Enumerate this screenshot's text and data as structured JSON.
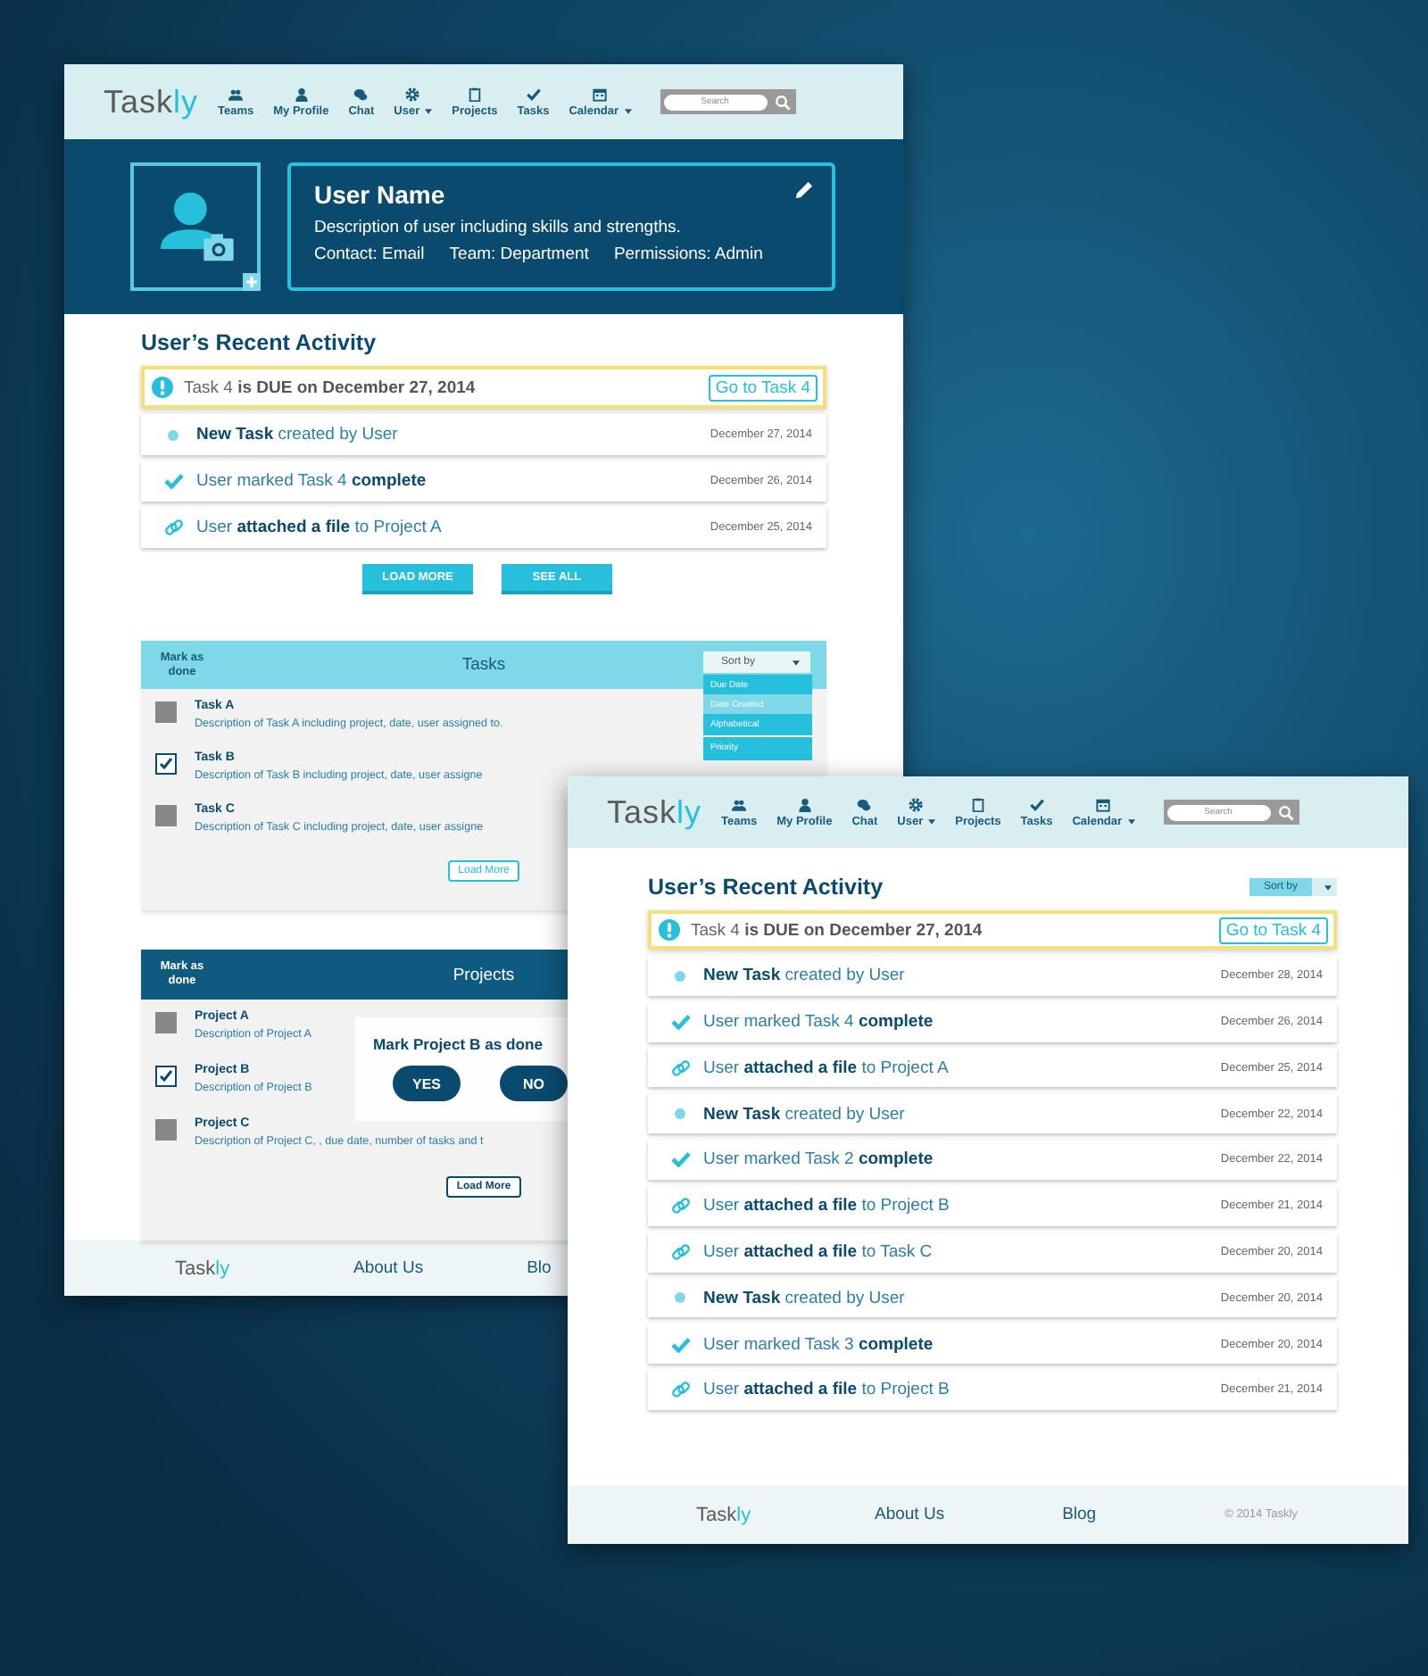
{
  "windows": [
    {
      "kind": "profile",
      "nav": {
        "logo": {
          "main": "Task",
          "accent": "ly"
        },
        "search": {
          "placeholder": "Search"
        },
        "items": [
          {
            "kind": "teams",
            "label": "Teams",
            "dropdown": false
          },
          {
            "kind": "profile",
            "label": "My Profile",
            "dropdown": false
          },
          {
            "kind": "chat",
            "label": "Chat",
            "dropdown": false
          },
          {
            "kind": "user",
            "label": "User",
            "dropdown": true
          },
          {
            "kind": "projects",
            "label": "Projects",
            "dropdown": false
          },
          {
            "kind": "tasks",
            "label": "Tasks",
            "dropdown": false
          },
          {
            "kind": "calendar",
            "label": "Calendar",
            "dropdown": true
          }
        ]
      },
      "profile": {
        "name": "User Name",
        "description": "Description of user including skills and strengths.",
        "contact": "Contact: Email",
        "team": "Team: Department",
        "permissions": "Permissions: Admin"
      },
      "activity": {
        "title": "User’s Recent Activity",
        "alert": {
          "text": "Task 4 **is DUE on December 27, 2014**",
          "button": "Go to Task 4"
        },
        "items": [
          {
            "kind": "new",
            "text": "**New Task** created by User",
            "date": "December 27, 2014"
          },
          {
            "kind": "complete",
            "text": "User marked Task 4 **complete**",
            "date": "December 26, 2014"
          },
          {
            "kind": "attach",
            "text": "User **attached a file** to Project A",
            "date": "December 25, 2014"
          }
        ],
        "buttons": [
          "LOAD MORE",
          "SEE ALL"
        ]
      },
      "tasks": {
        "mark_label": "Mark as done",
        "title": "Tasks",
        "sort": {
          "label": "Sort by",
          "options": [
            {
              "label": "Due Date",
              "selected": false
            },
            {
              "label": "Date Created",
              "selected": true
            },
            {
              "label": "Alphabetical",
              "selected": false
            },
            {
              "label": "Priority",
              "selected": false
            }
          ]
        },
        "items": [
          {
            "title": "Task A",
            "description": "Description of Task A including  project, date, user assigned to.",
            "checked": false
          },
          {
            "title": "Task B",
            "description": "Description of Task B  including  project, date, user assigne",
            "checked": true
          },
          {
            "title": "Task C",
            "description": "Description of Task C  including  project, date, user assigne",
            "checked": false
          }
        ],
        "button": "Load More"
      },
      "projects": {
        "mark_label": "Mark as done",
        "title": "Projects",
        "items": [
          {
            "title": "Project A",
            "description": "Description of Project A",
            "checked": false
          },
          {
            "title": "Project B",
            "description": "Description of Project B",
            "checked": true
          },
          {
            "title": "Project C",
            "description": "Description of Project C, , due date, number of tasks and t",
            "checked": false
          }
        ],
        "button": "Load More",
        "dialog": {
          "text": "Mark Project B as done",
          "buttons": [
            "YES",
            "NO"
          ]
        }
      },
      "footer": {
        "logo": {
          "main": "Task",
          "accent": "ly"
        },
        "links": [
          "About Us",
          "Blo"
        ]
      }
    },
    {
      "kind": "activity",
      "nav": {
        "logo": {
          "main": "Task",
          "accent": "ly"
        },
        "search": {
          "placeholder": "Search"
        },
        "items": [
          {
            "kind": "teams",
            "label": "Teams",
            "dropdown": false
          },
          {
            "kind": "profile",
            "label": "My Profile",
            "dropdown": false
          },
          {
            "kind": "chat",
            "label": "Chat",
            "dropdown": false
          },
          {
            "kind": "user",
            "label": "User",
            "dropdown": true
          },
          {
            "kind": "projects",
            "label": "Projects",
            "dropdown": false
          },
          {
            "kind": "tasks",
            "label": "Tasks",
            "dropdown": false
          },
          {
            "kind": "calendar",
            "label": "Calendar",
            "dropdown": true
          }
        ]
      },
      "activity": {
        "title": "User’s Recent Activity",
        "sort": {
          "label": "Sort by"
        },
        "alert": {
          "text": "Task 4 **is DUE on December 27, 2014**",
          "button": "Go to Task 4"
        },
        "items": [
          {
            "kind": "new",
            "text": "**New Task** created by User",
            "date": "December 28, 2014"
          },
          {
            "kind": "complete",
            "text": "User marked Task 4 **complete**",
            "date": "December 26, 2014"
          },
          {
            "kind": "attach",
            "text": "User **attached a file** to Project A",
            "date": "December 25, 2014"
          },
          {
            "kind": "new",
            "text": "**New Task** created by User",
            "date": "December 22, 2014"
          },
          {
            "kind": "complete",
            "text": "User marked Task 2 **complete**",
            "date": "December 22, 2014"
          },
          {
            "kind": "attach",
            "text": "User **attached a file** to Project B",
            "date": "December 21, 2014"
          },
          {
            "kind": "attach",
            "text": "User **attached a file** to Task C",
            "date": "December 20, 2014"
          },
          {
            "kind": "new",
            "text": "**New Task** created by User",
            "date": "December 20, 2014"
          },
          {
            "kind": "complete",
            "text": "User marked Task 3 **complete**",
            "date": "December 20, 2014"
          },
          {
            "kind": "attach",
            "text": "User **attached a file** to Project B",
            "date": "December 21, 2014"
          }
        ]
      },
      "footer": {
        "logo": {
          "main": "Task",
          "accent": "ly"
        },
        "links": [
          "About Us",
          "Blog"
        ],
        "copyright": "© 2014 Taskly"
      }
    }
  ]
}
